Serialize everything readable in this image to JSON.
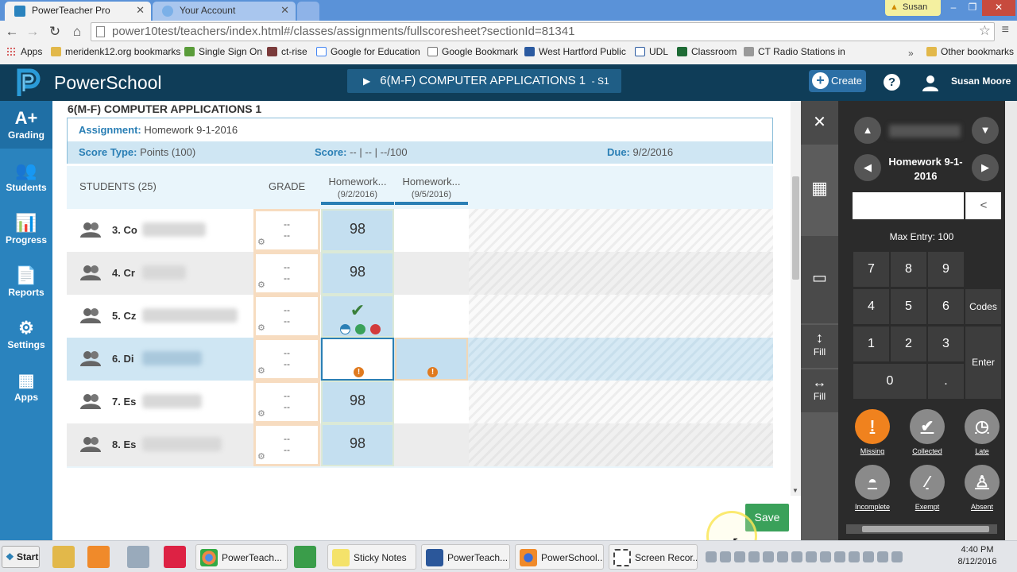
{
  "browser": {
    "tabs": [
      {
        "label": "PowerTeacher Pro"
      },
      {
        "label": "Your Account"
      }
    ],
    "window_user": "Susan",
    "url": "power10test/teachers/index.html#/classes/assignments/fullscoresheet?sectionId=81341",
    "bookmarks": [
      {
        "label": "Apps",
        "icon": "apps-icon"
      },
      {
        "label": "meridenk12.org bookmarks",
        "icon": "folder-icon"
      },
      {
        "label": "Single Sign On",
        "icon": "sso-icon"
      },
      {
        "label": "ct-rise",
        "icon": "chart-icon"
      },
      {
        "label": "Google for Education",
        "icon": "google-icon"
      },
      {
        "label": "Google Bookmark",
        "icon": "page-icon"
      },
      {
        "label": "West Hartford Public",
        "icon": "school-icon"
      },
      {
        "label": "UDL",
        "icon": "grid-icon"
      },
      {
        "label": "Classroom",
        "icon": "classroom-icon"
      },
      {
        "label": "CT Radio Stations in C",
        "icon": "radio-icon"
      }
    ],
    "bookmarks_overflow": "»",
    "other_bookmarks": "Other bookmarks"
  },
  "header": {
    "brand": "PowerSchool",
    "class_selector": "6(M-F) COMPUTER APPLICATIONS 1",
    "class_term": "S1",
    "create_label": "Create",
    "help_label": "?",
    "user_name": "Susan Moore"
  },
  "sidenav": [
    {
      "label": "Grading",
      "icon": "A+"
    },
    {
      "label": "Students",
      "icon": "👥"
    },
    {
      "label": "Progress",
      "icon": "📊"
    },
    {
      "label": "Reports",
      "icon": "📄"
    },
    {
      "label": "Settings",
      "icon": "⚙"
    },
    {
      "label": "Apps",
      "icon": "▦"
    }
  ],
  "main": {
    "class_title": "6(M-F) COMPUTER APPLICATIONS 1",
    "assignment_label": "Assignment:",
    "assignment_value": "Homework 9-1-2016",
    "score_type_label": "Score Type:",
    "score_type_value": "Points (100)",
    "score_label": "Score:",
    "score_value": "--  |  --  |  --/100",
    "due_label": "Due:",
    "due_value": "9/2/2016",
    "students_header": "STUDENTS (25)",
    "grade_header": "GRADE",
    "columns": [
      {
        "title": "Homework...",
        "date": "(9/2/2016)"
      },
      {
        "title": "Homework...",
        "date": "(9/5/2016)"
      }
    ],
    "rows": [
      {
        "name": "3. Co",
        "grade1": "--",
        "grade2": "--",
        "score1": "98",
        "score2": ""
      },
      {
        "name": "4. Cr",
        "grade1": "--",
        "grade2": "--",
        "score1": "98",
        "score2": ""
      },
      {
        "name": "5. Cz",
        "grade1": "--",
        "grade2": "--",
        "score1": "✔",
        "score2": ""
      },
      {
        "name": "6. Di",
        "grade1": "--",
        "grade2": "--",
        "score1": "",
        "score2": ""
      },
      {
        "name": "7. Es",
        "grade1": "--",
        "grade2": "--",
        "score1": "98",
        "score2": ""
      },
      {
        "name": "8. Es",
        "grade1": "--",
        "grade2": "--",
        "score1": "98",
        "score2": ""
      }
    ],
    "save_label": "Save"
  },
  "rail": {
    "close": "✕",
    "fill_vertical": "Fill",
    "fill_horizontal": "Fill"
  },
  "pad": {
    "assignment": "Homework 9-1-2016",
    "max_entry": "Max Entry: 100",
    "back": "<",
    "keys": [
      "7",
      "8",
      "9",
      "4",
      "5",
      "6",
      "1",
      "2",
      "3",
      "0",
      "."
    ],
    "codes": "Codes",
    "enter": "Enter",
    "flags": [
      {
        "label": "Missing",
        "symbol": "!"
      },
      {
        "label": "Collected",
        "symbol": "✔"
      },
      {
        "label": "Late",
        "symbol": "◷"
      },
      {
        "label": "Incomplete",
        "symbol": "◓"
      },
      {
        "label": "Exempt",
        "symbol": "⁄"
      },
      {
        "label": "Absent",
        "symbol": "♙"
      }
    ]
  },
  "taskbar": {
    "start": "Start",
    "items": [
      {
        "label": "PowerTeach..."
      },
      {
        "label": "Sticky Notes"
      },
      {
        "label": "PowerTeach..."
      },
      {
        "label": "PowerSchool..."
      },
      {
        "label": "Screen Recor..."
      }
    ],
    "time": "4:40 PM",
    "date": "8/12/2016"
  }
}
